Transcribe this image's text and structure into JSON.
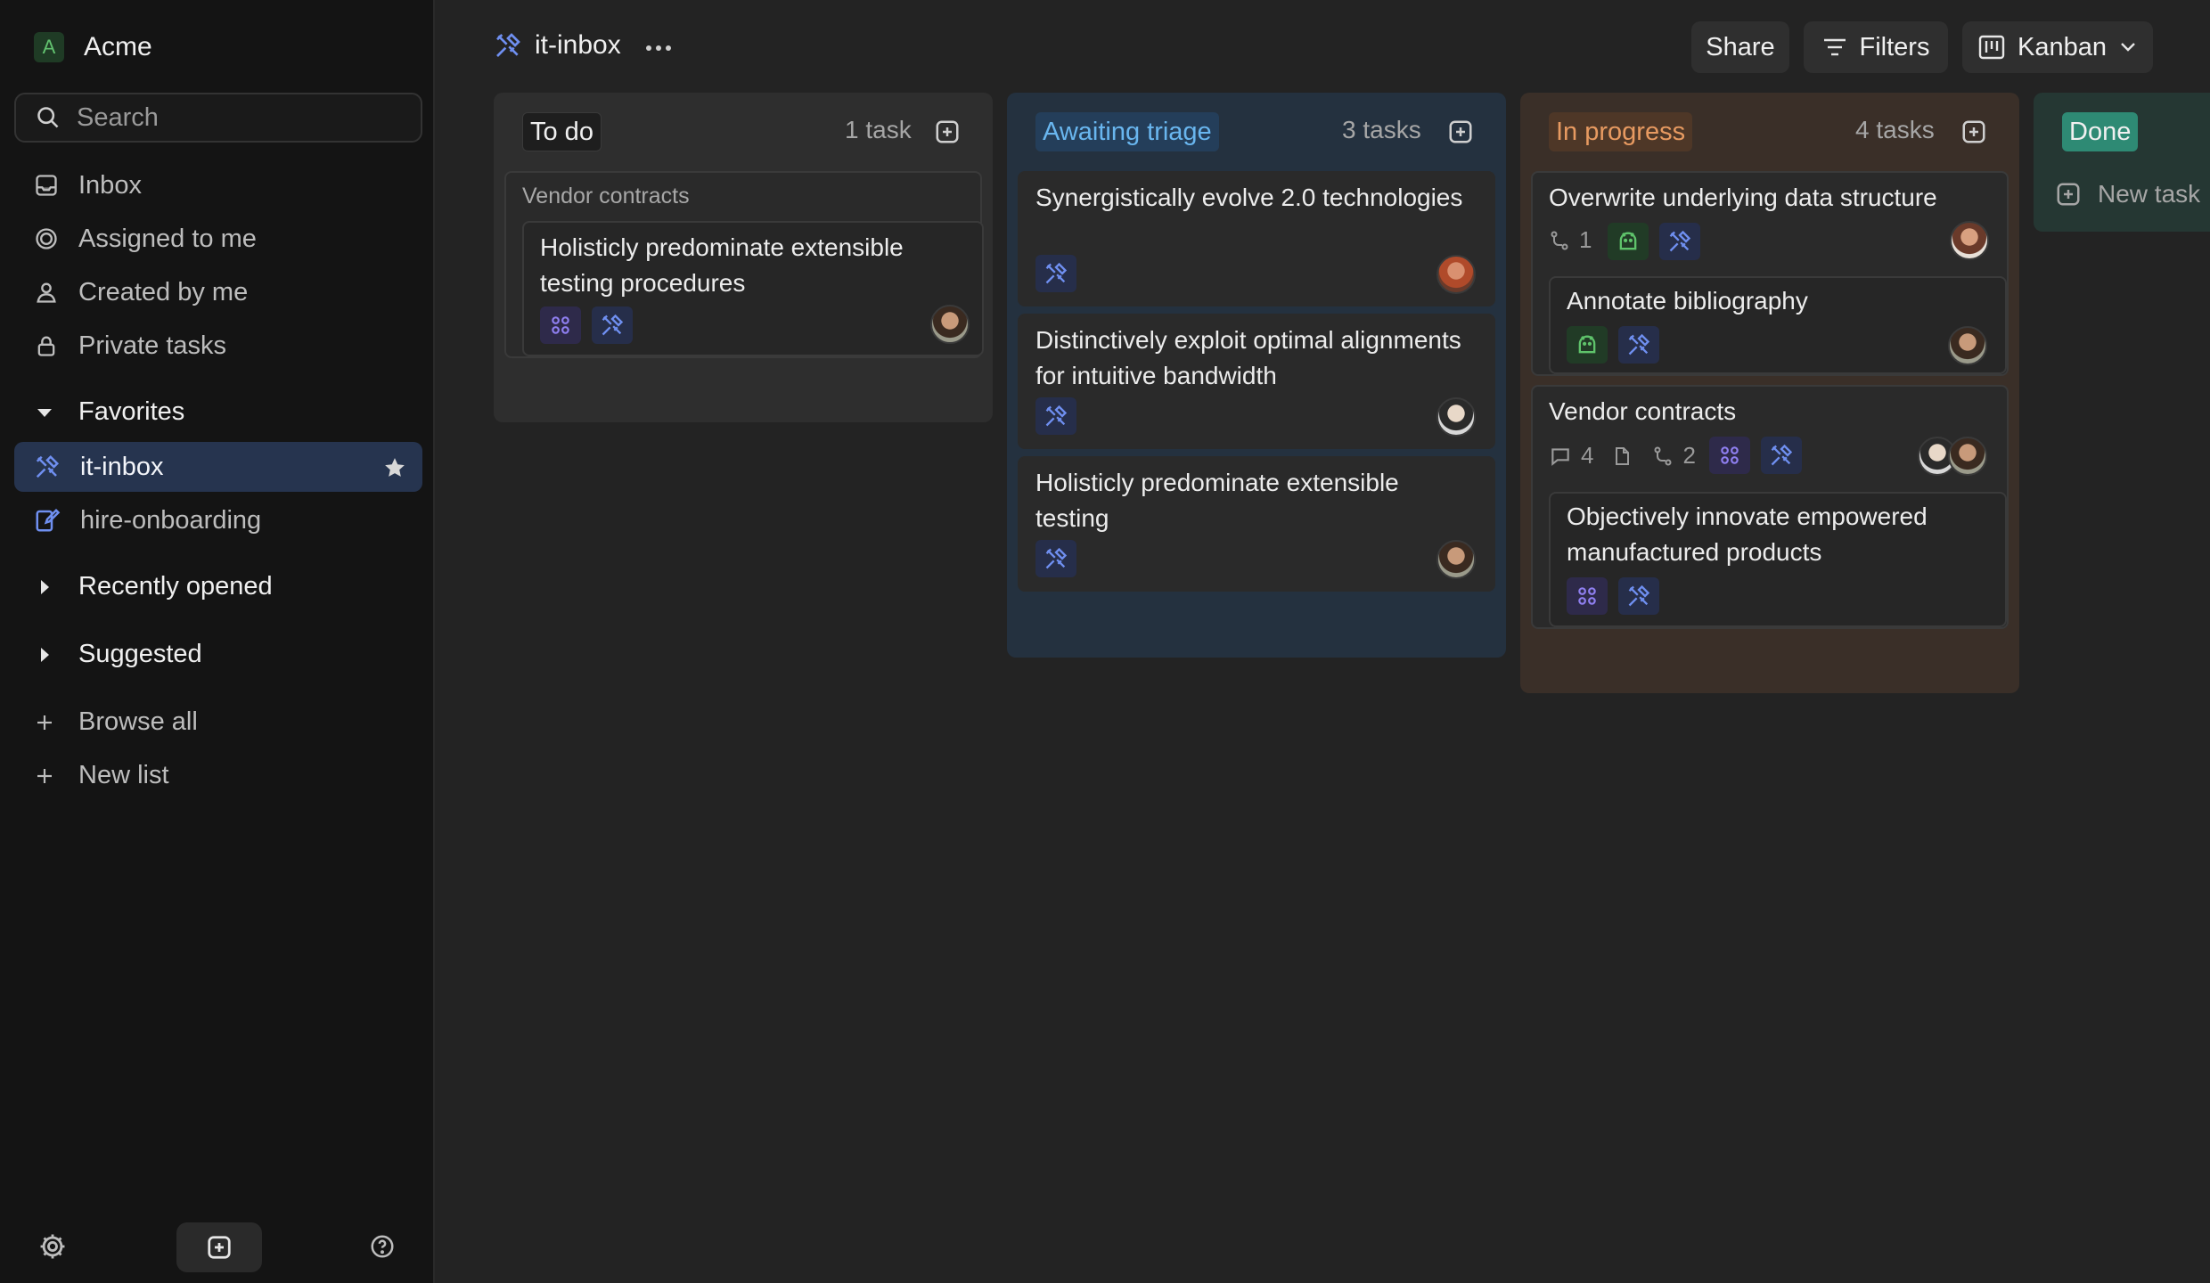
{
  "workspace": {
    "initial": "A",
    "name": "Acme"
  },
  "search": {
    "placeholder": "Search"
  },
  "nav": {
    "inbox": "Inbox",
    "assigned": "Assigned to me",
    "created": "Created by me",
    "private": "Private tasks"
  },
  "favorites": {
    "label": "Favorites",
    "items": [
      {
        "label": "it-inbox",
        "active": true
      },
      {
        "label": "hire-onboarding",
        "active": false
      }
    ]
  },
  "recently_opened": "Recently opened",
  "suggested": "Suggested",
  "browse_all": "Browse all",
  "new_list": "New list",
  "header": {
    "title": "it-inbox",
    "share": "Share",
    "filters": "Filters",
    "view": "Kanban"
  },
  "columns": [
    {
      "name": "To do",
      "count": "1 task",
      "group_label": "Vendor contracts",
      "cards": [
        {
          "title": "Holisticly predominate extensible testing procedures"
        }
      ]
    },
    {
      "name": "Awaiting triage",
      "count": "3 tasks",
      "cards": [
        {
          "title": "Synergistically evolve 2.0 technologies"
        },
        {
          "title": "Distinctively exploit optimal alignments for intuitive bandwidth"
        },
        {
          "title": "Holisticly predominate extensible testing"
        }
      ]
    },
    {
      "name": "In progress",
      "count": "4 tasks",
      "cards": [
        {
          "title": "Overwrite underlying data structure",
          "subtasks": "1"
        },
        {
          "title": "Annotate bibliography"
        },
        {
          "title": "Vendor contracts",
          "comments": "4",
          "subtasks": "2"
        },
        {
          "title": "Objectively innovate empowered manufactured products"
        }
      ]
    },
    {
      "name": "Done",
      "new_task": "New task"
    }
  ],
  "colors": {
    "accent_blue": "#6f8ff0",
    "tag_purple": "#8f7ff0",
    "tag_green": "#5fc36b",
    "triage": "#69b6ef",
    "in_progress": "#e79a61",
    "done": "#5fe0c4"
  },
  "icons": [
    "search-icon",
    "inbox-icon",
    "target-icon",
    "user-icon",
    "lock-icon",
    "chevron-icon",
    "tools-icon",
    "onboarding-icon",
    "star-icon",
    "plus-icon",
    "gear-icon",
    "new-icon",
    "help-icon",
    "more-icon",
    "filter-icon",
    "kanban-icon",
    "chevron-down-icon",
    "square-plus-icon",
    "grid-icon",
    "android-icon",
    "comment-icon",
    "document-icon",
    "subtask-icon"
  ]
}
